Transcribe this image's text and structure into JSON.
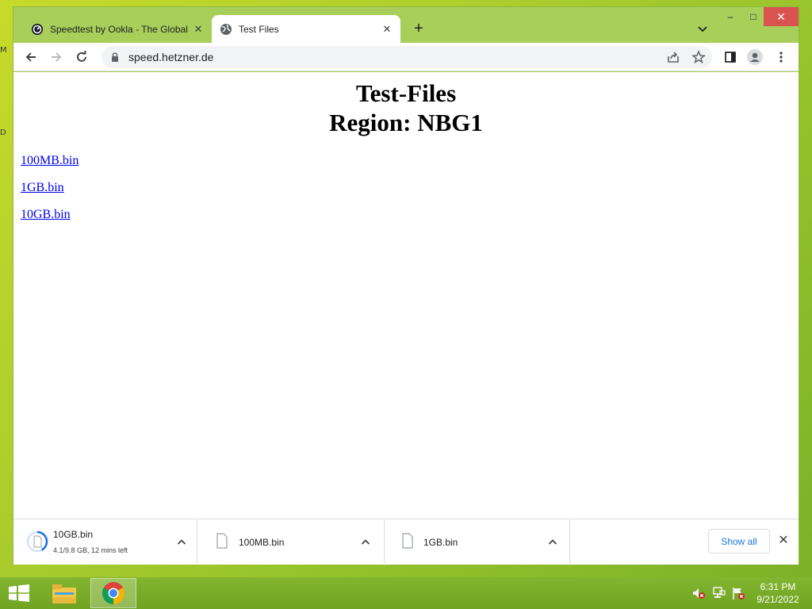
{
  "desktop": {
    "edge_glyphs": [
      "M",
      "D"
    ]
  },
  "tabs": [
    {
      "title": "Speedtest by Ookla - The Global",
      "icon": "speedtest-icon",
      "active": false
    },
    {
      "title": "Test Files",
      "icon": "globe-icon",
      "active": true
    }
  ],
  "tab_close_glyph": "✕",
  "new_tab_glyph": "+",
  "window_controls": {
    "minimize": "–",
    "maximize": "□",
    "close": "✕"
  },
  "address_bar": {
    "url": "speed.hetzner.de"
  },
  "page": {
    "heading_line1": "Test-Files",
    "heading_line2": "Region: NBG1",
    "links": [
      "100MB.bin",
      "1GB.bin",
      "10GB.bin"
    ]
  },
  "downloads": [
    {
      "name": "10GB.bin",
      "status": "4.1/9.8 GB, 12 mins left",
      "progress": 0.42,
      "in_progress": true
    },
    {
      "name": "100MB.bin",
      "status": "",
      "in_progress": false
    },
    {
      "name": "1GB.bin",
      "status": "",
      "in_progress": false
    }
  ],
  "download_bar": {
    "show_all_label": "Show all",
    "close_glyph": "✕"
  },
  "taskbar": {
    "apps": [
      "file-explorer-icon",
      "chrome-icon"
    ],
    "tray_icons": [
      "volume-muted-icon",
      "network-icon",
      "action-center-flag-icon"
    ],
    "clock_time": "6:31 PM",
    "clock_date": "9/21/2022"
  },
  "colors": {
    "desktop_green": "#a8cc2c",
    "window_frame": "#a7cf5a",
    "link": "#0000ee",
    "accent_blue": "#1a73e8",
    "close_red": "#d9534f"
  }
}
